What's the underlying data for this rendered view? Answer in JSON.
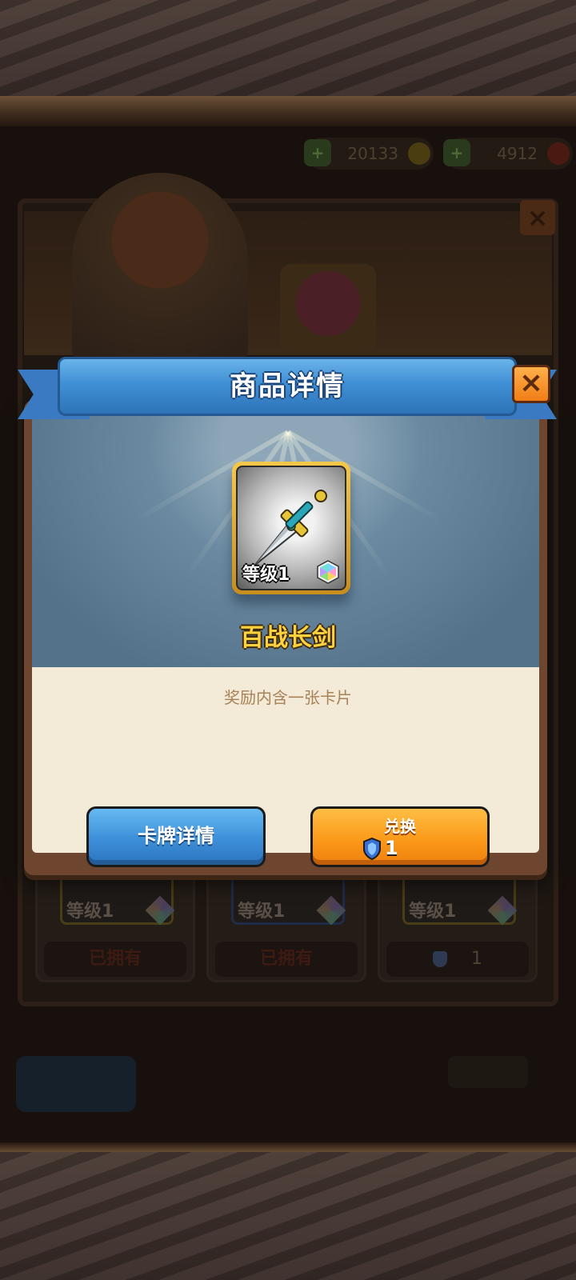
{
  "background": {
    "currencies": [
      {
        "value": "20133",
        "icon": "gold-coin-icon"
      },
      {
        "value": "4912",
        "icon": "ruby-icon"
      }
    ],
    "cards": [
      {
        "level": "等级1",
        "status": "已拥有"
      },
      {
        "level": "等级1",
        "status": "已拥有"
      },
      {
        "level": "等级1",
        "price": "1"
      }
    ]
  },
  "dialog": {
    "title": "商品详情",
    "item": {
      "name": "百战长剑",
      "level": "等级1",
      "icon": "sword-icon"
    },
    "description": "奖励内含一张卡片",
    "buttons": {
      "card_details": "卡牌详情",
      "exchange_label": "兑换",
      "exchange_cost": "1"
    }
  },
  "colors": {
    "ribbon_blue": "#3f8fd4",
    "exchange_orange": "#fb9a1a",
    "item_name_gold": "#ffd23d",
    "description_brown": "#a88257"
  }
}
